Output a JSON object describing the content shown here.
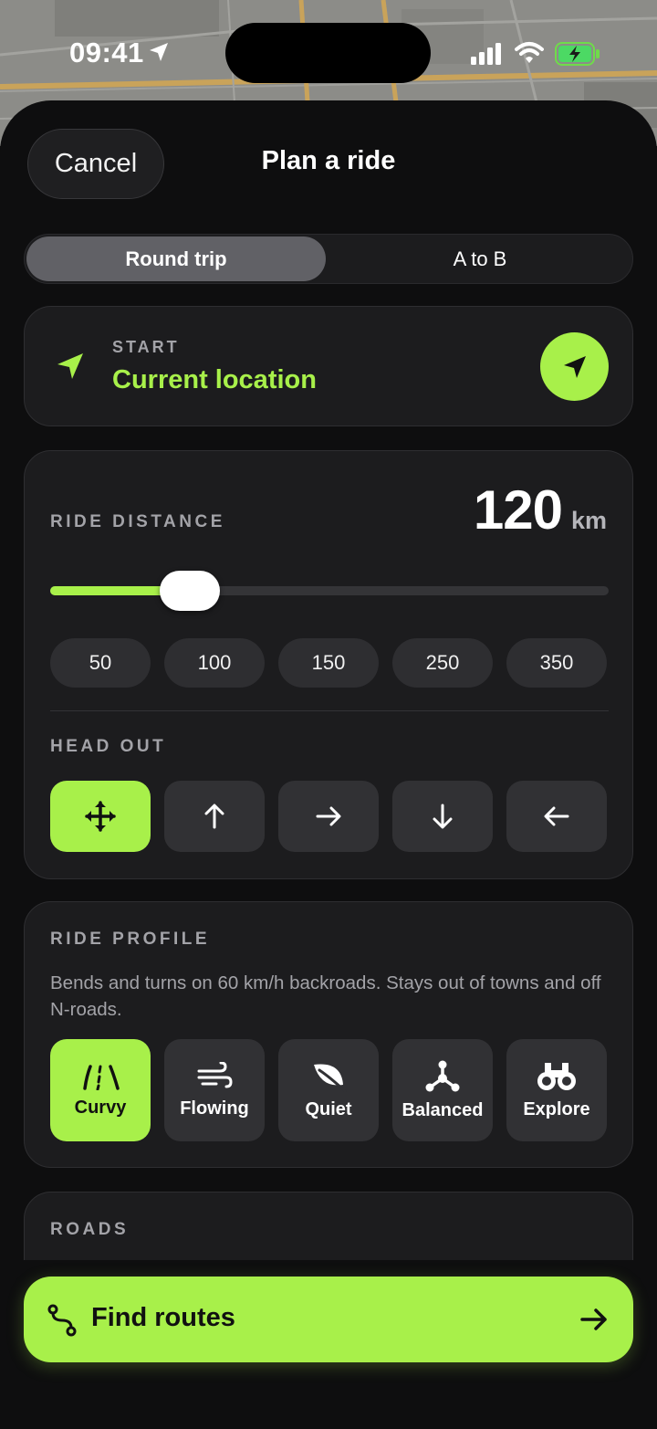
{
  "status_bar": {
    "time": "09:41"
  },
  "header": {
    "cancel_label": "Cancel",
    "title": "Plan a ride"
  },
  "trip_type": {
    "options": [
      "Round trip",
      "A to B"
    ],
    "selected": "Round trip"
  },
  "start": {
    "label": "START",
    "value": "Current location",
    "icon": "location-arrow-icon",
    "locate_icon": "navigation-arrow-icon"
  },
  "distance": {
    "label": "RIDE DISTANCE",
    "value": "120",
    "unit": "km",
    "slider_fraction": 0.25,
    "presets": [
      "50",
      "100",
      "150",
      "250",
      "350"
    ]
  },
  "head_out": {
    "label": "HEAD OUT",
    "options": [
      "any-direction-icon",
      "north-arrow-icon",
      "east-arrow-icon",
      "south-arrow-icon",
      "west-arrow-icon"
    ],
    "selected": "any-direction-icon"
  },
  "profile": {
    "label": "RIDE PROFILE",
    "description": "Bends and turns on 60 km/h backroads. Stays out of towns and off N-roads.",
    "options": [
      {
        "label": "Curvy",
        "icon": "curvy-road-icon"
      },
      {
        "label": "Flowing",
        "icon": "wind-icon"
      },
      {
        "label": "Quiet",
        "icon": "leaf-icon"
      },
      {
        "label": "Balanced",
        "icon": "nodes-icon"
      },
      {
        "label": "Explore",
        "icon": "binoculars-icon"
      }
    ],
    "selected": "Curvy"
  },
  "roads": {
    "label": "ROADS"
  },
  "cta": {
    "label": "Find routes",
    "icon": "route-icon",
    "arrow_icon": "arrow-right-icon"
  },
  "colors": {
    "accent": "#a8f04a",
    "card": "#1c1c1e",
    "background": "#0e0e0f"
  }
}
